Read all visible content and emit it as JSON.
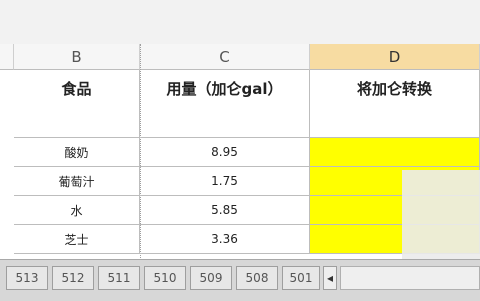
{
  "columns": {
    "b": "B",
    "c": "C",
    "d": "D"
  },
  "headers": {
    "b": "食品",
    "c": "用量（加仑gal）",
    "d": "将加仑转换"
  },
  "rows": [
    {
      "food": "酸奶",
      "amount": "8.95"
    },
    {
      "food": "葡萄汁",
      "amount": "1.75"
    },
    {
      "food": "水",
      "amount": "5.85"
    },
    {
      "food": "芝士",
      "amount": "3.36"
    }
  ],
  "sheet_tabs": [
    "513",
    "512",
    "511",
    "510",
    "509",
    "508",
    "501"
  ],
  "nav": {
    "left_arrow": "◂"
  },
  "colors": {
    "highlight": "#ffff00",
    "selected_column": "#f7dca2"
  }
}
